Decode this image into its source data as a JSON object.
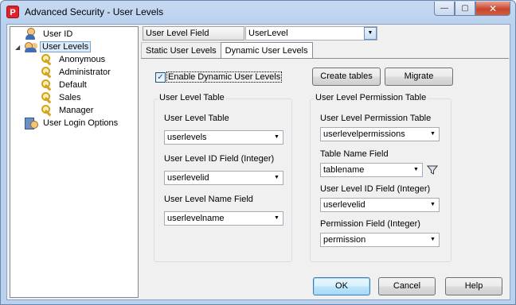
{
  "window": {
    "title": "Advanced Security - User Levels",
    "app_icon_glyph": "P"
  },
  "caption": {
    "minimize": "—",
    "maximize": "▢",
    "close": "✕"
  },
  "tree": {
    "items": [
      {
        "label": "User ID",
        "icon": "user-icon"
      },
      {
        "label": "User Levels",
        "icon": "users-icon",
        "expander": "◢"
      },
      {
        "label": "Anonymous",
        "icon": "key-icon"
      },
      {
        "label": "Administrator",
        "icon": "key-icon"
      },
      {
        "label": "Default",
        "icon": "key-icon"
      },
      {
        "label": "Sales",
        "icon": "key-icon"
      },
      {
        "label": "Manager",
        "icon": "key-icon"
      },
      {
        "label": "User Login Options",
        "icon": "login-icon"
      }
    ]
  },
  "top": {
    "field_label": "User Level Field (Integer)",
    "field_value": "UserLevel"
  },
  "tabs": [
    {
      "label": "Static User Levels"
    },
    {
      "label": "Dynamic User Levels"
    }
  ],
  "dynamic": {
    "enable_label": "Enable Dynamic User Levels",
    "enable_checked": true,
    "checkbox_glyph": "✓",
    "create_tables": "Create tables",
    "migrate": "Migrate"
  },
  "user_level_table": {
    "title": "User Level Table",
    "table_label": "User Level Table",
    "table_value": "userlevels",
    "id_label": "User Level ID Field (Integer)",
    "id_value": "userlevelid",
    "name_label": "User Level Name Field",
    "name_value": "userlevelname"
  },
  "permission_table": {
    "title": "User Level Permission Table",
    "table_label": "User Level Permission Table",
    "table_value": "userlevelpermissions",
    "tablename_label": "Table Name Field",
    "tablename_value": "tablename",
    "id_label": "User Level ID Field (Integer)",
    "id_value": "userlevelid",
    "perm_label": "Permission Field (Integer)",
    "perm_value": "permission"
  },
  "dropdown_glyph": "▼",
  "buttons": {
    "ok": "OK",
    "cancel": "Cancel",
    "help": "Help"
  }
}
